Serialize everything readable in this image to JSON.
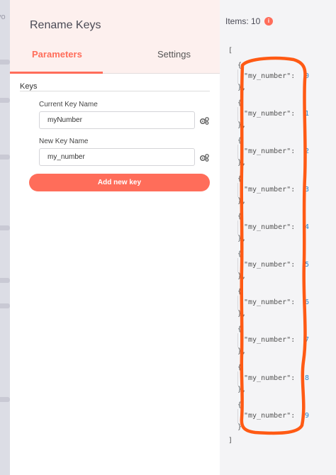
{
  "background": {
    "side_text": "vo"
  },
  "node": {
    "title": "Rename Keys",
    "tabs": [
      {
        "label": "Parameters",
        "active": true
      },
      {
        "label": "Settings",
        "active": false
      }
    ],
    "keys_label": "Keys",
    "current_key": {
      "label": "Current Key Name",
      "value": "myNumber"
    },
    "new_key": {
      "label": "New Key Name",
      "value": "my_number"
    },
    "add_button": "Add new key"
  },
  "output": {
    "items_label": "Items: 10",
    "info_icon": "i",
    "open_bracket": "[",
    "close_bracket": "]",
    "items": [
      {
        "key": "\"my_number\":",
        "value": "0"
      },
      {
        "key": "\"my_number\":",
        "value": "1"
      },
      {
        "key": "\"my_number\":",
        "value": "2"
      },
      {
        "key": "\"my_number\":",
        "value": "3"
      },
      {
        "key": "\"my_number\":",
        "value": "4"
      },
      {
        "key": "\"my_number\":",
        "value": "5"
      },
      {
        "key": "\"my_number\":",
        "value": "6"
      },
      {
        "key": "\"my_number\":",
        "value": "7"
      },
      {
        "key": "\"my_number\":",
        "value": "8"
      },
      {
        "key": "\"my_number\":",
        "value": "9"
      }
    ]
  },
  "colors": {
    "accent": "#ff6d5a",
    "annotation": "#ff5a14",
    "number": "#2d84c9"
  }
}
